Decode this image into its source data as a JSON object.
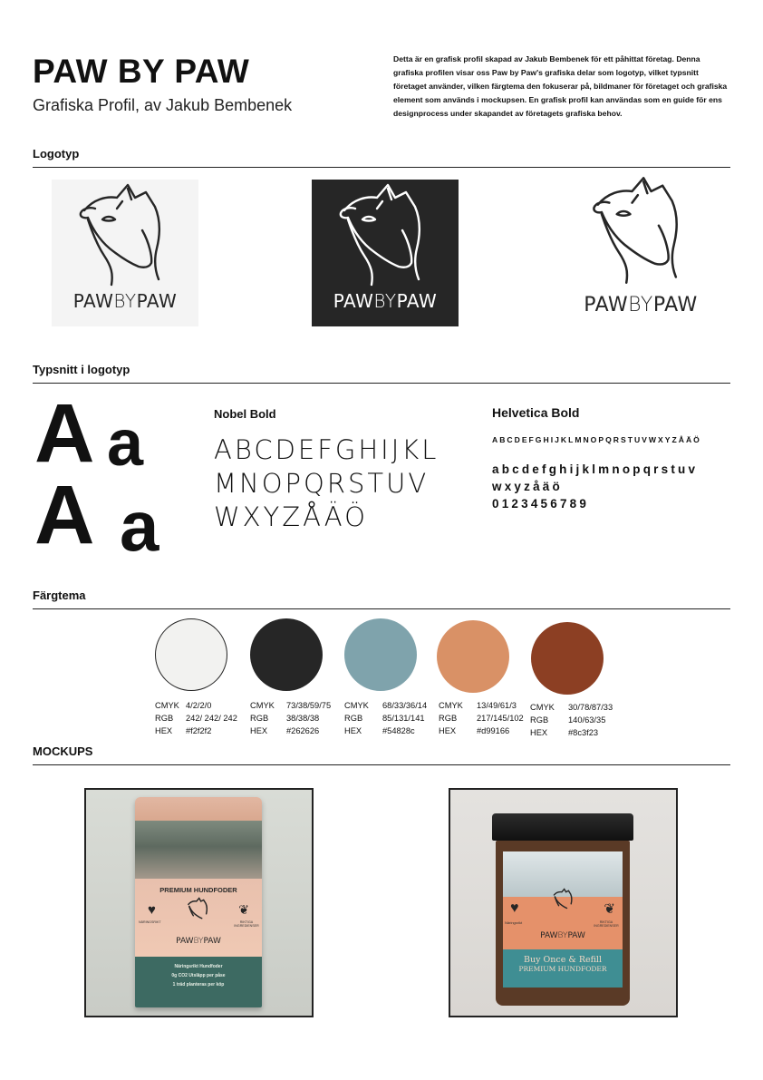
{
  "header": {
    "title": "PAW BY PAW",
    "subtitle": "Grafiska Profil, av Jakub Bembenek",
    "intro": "Detta är en grafisk profil skapad av Jakub Bembenek för ett påhittat företag. Denna grafiska profilen visar oss Paw by Paw's grafiska delar som logotyp, vilket typsnitt företaget använder, vilken färgtema den fokuserar på, bildmaner för företaget och grafiska element som används i mockupsen. En grafisk profil kan användas som en guide för ens designprocess under skapandet av företagets grafiska behov."
  },
  "sections": {
    "logotyp": "Logotyp",
    "typsnitt": "Typsnitt i logotyp",
    "fargtema": "Färgtema",
    "mockups": "MOCKUPS"
  },
  "logo": {
    "paw1": "PAW",
    "by": "BY",
    "paw2": "PAW",
    "variants": [
      {
        "bg": "#f4f4f4",
        "fg": "#262626"
      },
      {
        "bg": "#262626",
        "fg": "#ffffff"
      },
      {
        "bg": "#ffffff",
        "fg": "#262626"
      }
    ]
  },
  "typography": {
    "sample_upper": "A",
    "sample_lower": "a",
    "nobel": {
      "name": "Nobel Bold",
      "lines": [
        "ABCDEFGHIJKL",
        "MNOPQRSTUV",
        "WXYZÅÄÖ"
      ]
    },
    "helvetica": {
      "name": "Helvetica Bold",
      "upper": "ABCDEFGHIJKLMNOPQRSTUVWXYZÅÄÖ",
      "lower1": "abcdefghijklmnopqrstuv",
      "lower2": "wxyzåäö",
      "digits": "0123456789"
    }
  },
  "colors": [
    {
      "swatch": "#f2f2f0",
      "cmyk": "4/2/2/0",
      "rgb": "242/ 242/ 242",
      "hex": "#f2f2f2"
    },
    {
      "swatch": "#262626",
      "cmyk": "73/38/59/75",
      "rgb": "38/38/38",
      "hex": "#262626"
    },
    {
      "swatch": "#7fa3ac",
      "cmyk": "68/33/36/14",
      "rgb": "85/131/141",
      "hex": "#54828c"
    },
    {
      "swatch": "#d99166",
      "cmyk": "13/49/61/3",
      "rgb": "217/145/102",
      "hex": "#d99166"
    },
    {
      "swatch": "#8c3f23",
      "cmyk": "30/78/87/33",
      "rgb": "140/63/35",
      "hex": "#8c3f23"
    }
  ],
  "color_labels": {
    "cmyk": "CMYK",
    "rgb": "RGB",
    "hex": "HEX"
  },
  "mockups": {
    "bag": {
      "product": "PREMIUM HUNDFODER",
      "left_badge": "NÄRINGSRIKT",
      "right_badge": "RIKTIGA INGREDIENSER",
      "line1": "Näringsrikt Hundfoder",
      "line2": "0g CO2 Utsläpp per påse",
      "line3": "1 träd planteras per köp"
    },
    "jar": {
      "left_badge": "Näringsrikt",
      "right_badge": "RIKTIGA INGREDIENSER",
      "tagline": "Buy Once & Refill",
      "product": "PREMIUM HUNDFODER"
    }
  }
}
